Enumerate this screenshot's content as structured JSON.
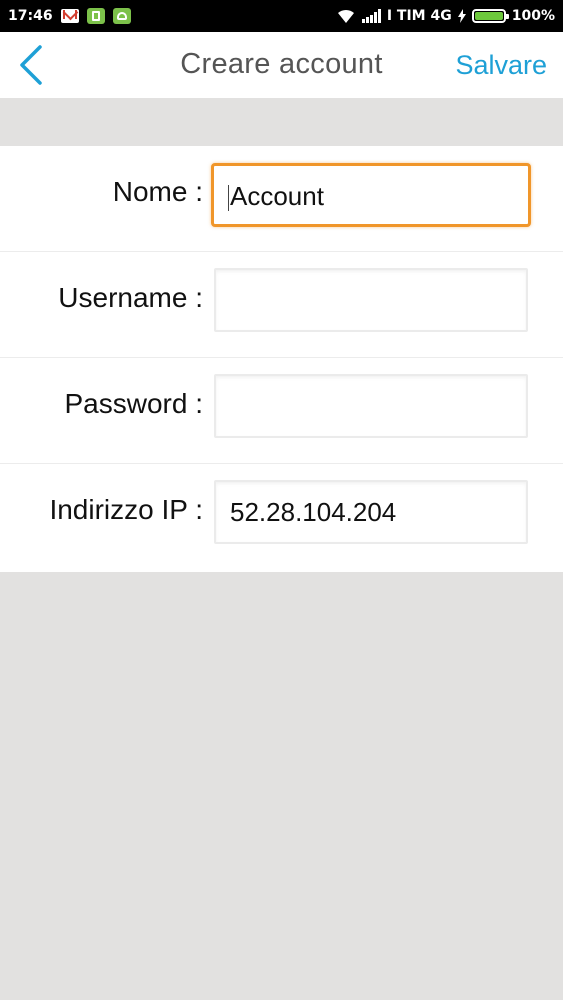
{
  "status_bar": {
    "time": "17:46",
    "carrier": "I TIM 4G",
    "battery_percent": "100%",
    "icons": [
      "gmail-icon",
      "battery-saver-icon",
      "android-icon",
      "wifi-icon",
      "signal-icon",
      "charging-icon",
      "battery-icon"
    ]
  },
  "header": {
    "title": "Creare account",
    "save_label": "Salvare",
    "back_icon": "chevron-left-icon"
  },
  "form": {
    "fields": [
      {
        "label": "Nome :",
        "value": "Account",
        "focused": true
      },
      {
        "label": "Username :",
        "value": ""
      },
      {
        "label": "Password :",
        "value": ""
      },
      {
        "label": "Indirizzo IP :",
        "value": "52.28.104.204"
      }
    ]
  },
  "colors": {
    "accent": "#1ea0d6",
    "focus_border": "#f0962a",
    "background": "#e2e1e0"
  }
}
